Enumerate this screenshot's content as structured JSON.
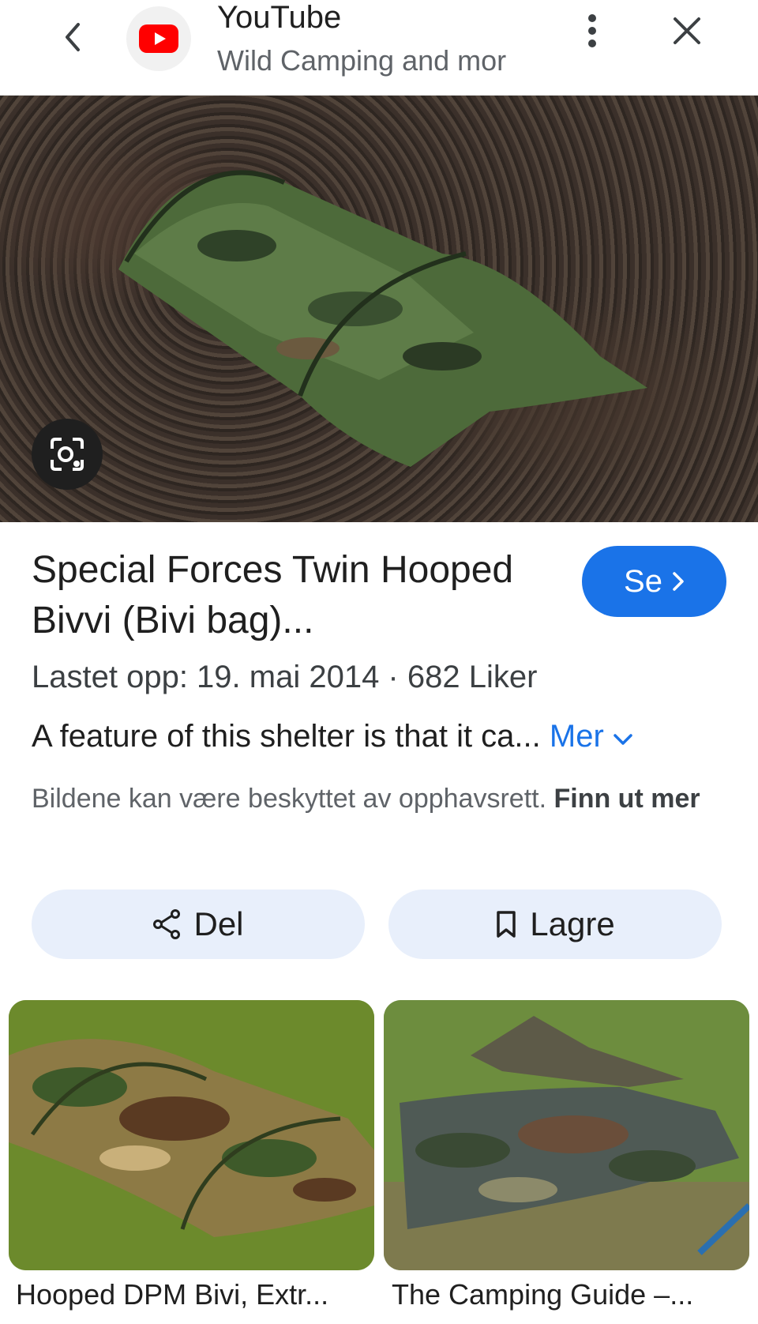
{
  "header": {
    "back_icon": "chevron-left-icon",
    "source_logo": "youtube-icon",
    "site_name": "YouTube",
    "page_title": "Wild Camping and mor",
    "menu_icon": "more-vert-icon",
    "close_icon": "close-icon"
  },
  "hero": {
    "lens_icon": "google-lens-icon"
  },
  "result": {
    "title": "Special Forces Twin Hooped Bivvi (Bivi bag)...",
    "watch_label": "Se",
    "meta": "Lastet opp: 19. mai 2014 · 682 Liker",
    "description": "A feature of this shelter is that it ca...",
    "more_label": "Mer",
    "copyright_text": "Bildene kan være beskyttet av opphavsrett.",
    "learn_more": "Finn ut mer"
  },
  "actions": {
    "share_label": "Del",
    "save_label": "Lagre"
  },
  "related": [
    {
      "caption": "Hooped DPM Bivi, Extr..."
    },
    {
      "caption": "The Camping Guide –..."
    }
  ],
  "colors": {
    "accent": "#1a73e8",
    "youtube_red": "#ff0000",
    "pill_bg": "#e8effb"
  }
}
